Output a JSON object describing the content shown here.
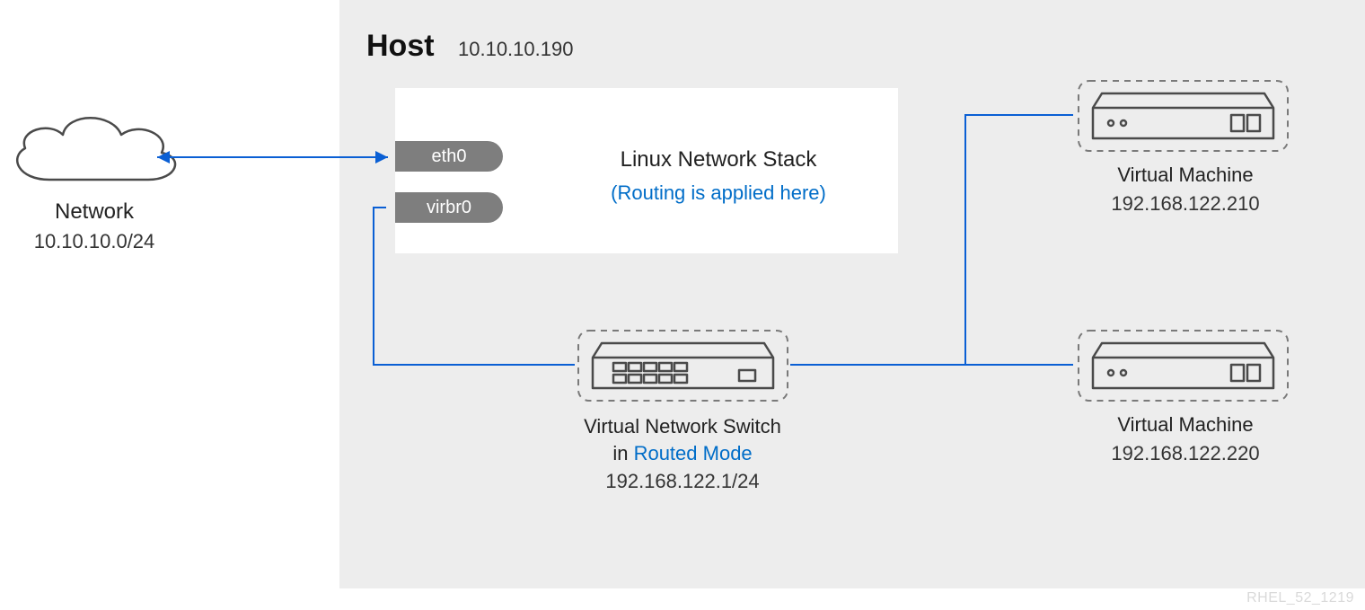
{
  "host": {
    "title": "Host",
    "ip": "10.10.10.190"
  },
  "stack": {
    "title": "Linux Network Stack",
    "note": "(Routing is applied here)",
    "iface_eth": "eth0",
    "iface_virbr": "virbr0"
  },
  "network": {
    "label": "Network",
    "cidr": "10.10.10.0/24"
  },
  "switch": {
    "line1": "Virtual Network Switch",
    "line2_prefix": "in ",
    "line2_mode": "Routed Mode",
    "ip": "192.168.122.1/24"
  },
  "vm1": {
    "label": "Virtual Machine",
    "ip": "192.168.122.210"
  },
  "vm2": {
    "label": "Virtual Machine",
    "ip": "192.168.122.220"
  },
  "footer": "RHEL_52_1219"
}
